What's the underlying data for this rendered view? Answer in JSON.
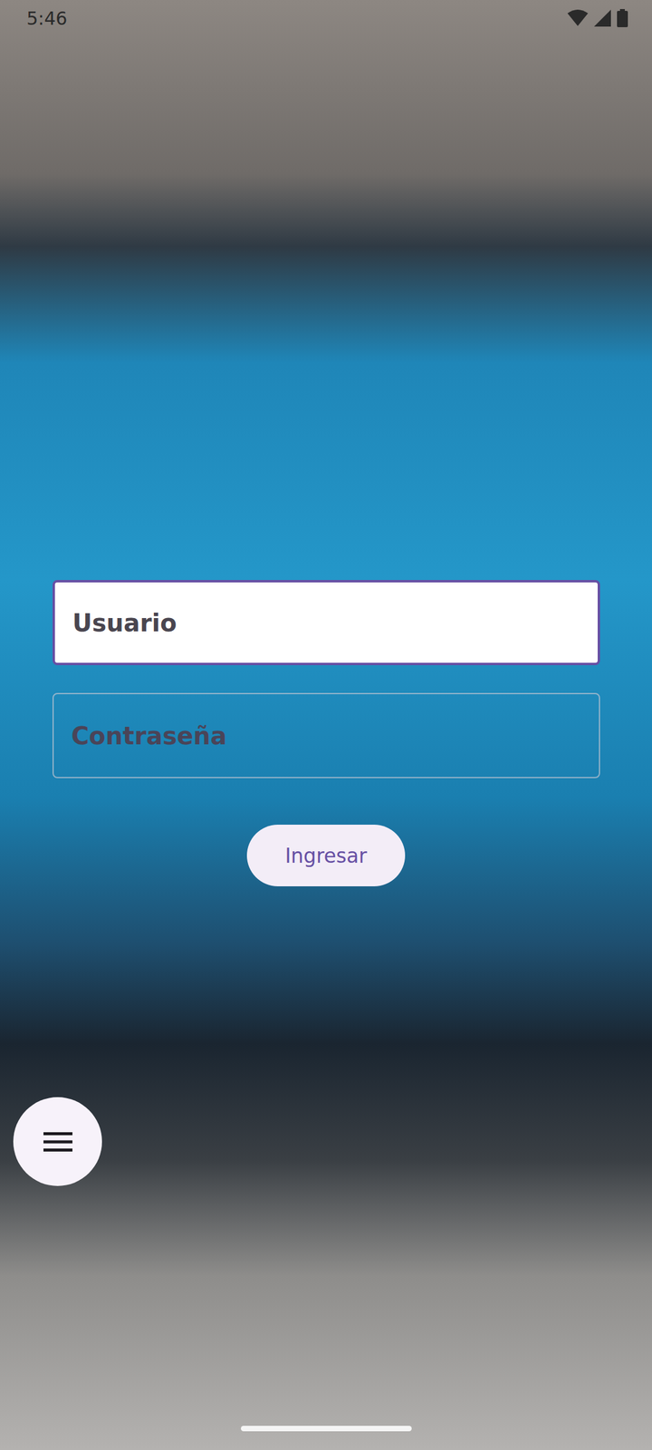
{
  "status_bar": {
    "time": "5:46"
  },
  "fields": [
    {
      "label": "Usuario",
      "focused": true
    },
    {
      "label": "Contraseña",
      "focused": false
    }
  ],
  "submit_button": {
    "label": "Ingresar"
  }
}
